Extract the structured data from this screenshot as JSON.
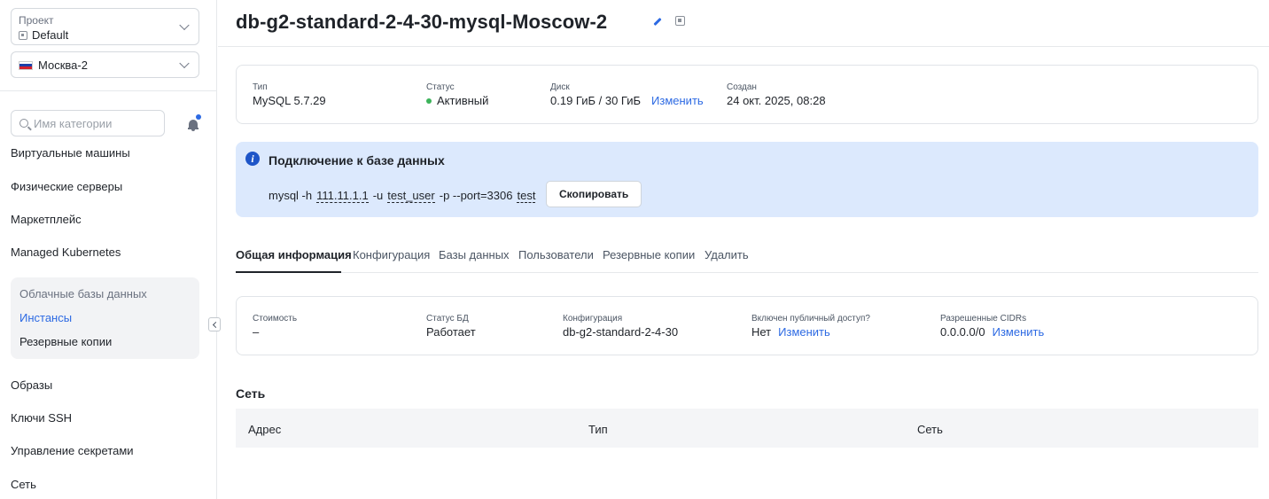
{
  "sidebar": {
    "project": {
      "label": "Проект",
      "value": "Default"
    },
    "region": {
      "value": "Москва-2",
      "flag_colors": [
        "#ffffff",
        "#1c3fa8",
        "#d3212d"
      ]
    },
    "search": {
      "placeholder": "Имя категории"
    },
    "nav": [
      {
        "label": "Виртуальные машины"
      },
      {
        "label": "Физические серверы"
      },
      {
        "label": "Маркетплейс"
      },
      {
        "label": "Managed Kubernetes"
      }
    ],
    "subnav": {
      "heading": "Облачные базы данных",
      "items": [
        {
          "label": "Инстансы",
          "active": true
        },
        {
          "label": "Резервные копии",
          "active": false
        }
      ]
    },
    "nav_bottom": [
      {
        "label": "Образы"
      },
      {
        "label": "Ключи SSH"
      },
      {
        "label": "Управление секретами"
      },
      {
        "label": "Сеть"
      }
    ]
  },
  "header": {
    "title": "db-g2-standard-2-4-30-mysql-Moscow-2"
  },
  "summary": {
    "type": {
      "label": "Тип",
      "value": "MySQL 5.7.29"
    },
    "status": {
      "label": "Статус",
      "value": "Активный"
    },
    "disk": {
      "label": "Диск",
      "value": "0.19 ГиБ / 30 ГиБ",
      "action": "Изменить"
    },
    "created": {
      "label": "Создан",
      "value": "24 окт. 2025, 08:28"
    }
  },
  "connection": {
    "title": "Подключение к базе данных",
    "command": {
      "p1": "mysql -h",
      "host": "111.11.1.1",
      "p2": "-u",
      "user": "test_user",
      "p3": "-p --port=3306",
      "db": "test"
    },
    "copy_label": "Скопировать"
  },
  "tabs": [
    {
      "label": "Общая информация",
      "active": true
    },
    {
      "label": "Конфигурация"
    },
    {
      "label": "Базы данных"
    },
    {
      "label": "Пользователи"
    },
    {
      "label": "Резервные копии"
    },
    {
      "label": "Удалить"
    }
  ],
  "details": {
    "cost": {
      "label": "Стоимость",
      "value": "–"
    },
    "db_status": {
      "label": "Статус БД",
      "value": "Работает"
    },
    "config": {
      "label": "Конфигурация",
      "value": "db-g2-standard-2-4-30"
    },
    "public_access": {
      "label": "Включен публичный доступ?",
      "value": "Нет",
      "action": "Изменить"
    },
    "cidrs": {
      "label": "Разрешенные CIDRs",
      "value": "0.0.0.0/0",
      "action": "Изменить"
    }
  },
  "network": {
    "title": "Сеть",
    "columns": [
      "Адрес",
      "Тип",
      "Сеть"
    ]
  },
  "colors": {
    "accent": "#2d6ae3",
    "status_active": "#3cb35a",
    "info_bg": "#dce9fd"
  }
}
